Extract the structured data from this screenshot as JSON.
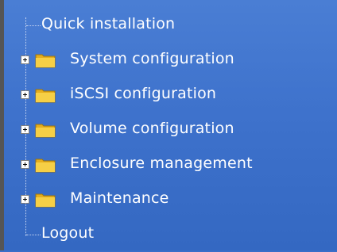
{
  "menu": {
    "items": [
      {
        "label": "Quick installation",
        "type": "leaf",
        "icon": ""
      },
      {
        "label": "System configuration",
        "type": "folder",
        "icon": "folder-icon"
      },
      {
        "label": "iSCSI configuration",
        "type": "folder",
        "icon": "folder-icon"
      },
      {
        "label": "Volume configuration",
        "type": "folder",
        "icon": "folder-icon"
      },
      {
        "label": "Enclosure management",
        "type": "folder",
        "icon": "folder-icon"
      },
      {
        "label": "Maintenance",
        "type": "folder",
        "icon": "folder-icon"
      },
      {
        "label": "Logout",
        "type": "leaf",
        "icon": ""
      }
    ]
  },
  "colors": {
    "background": "#3e72cc",
    "text": "#ffffff",
    "folder": "#f4c531"
  }
}
